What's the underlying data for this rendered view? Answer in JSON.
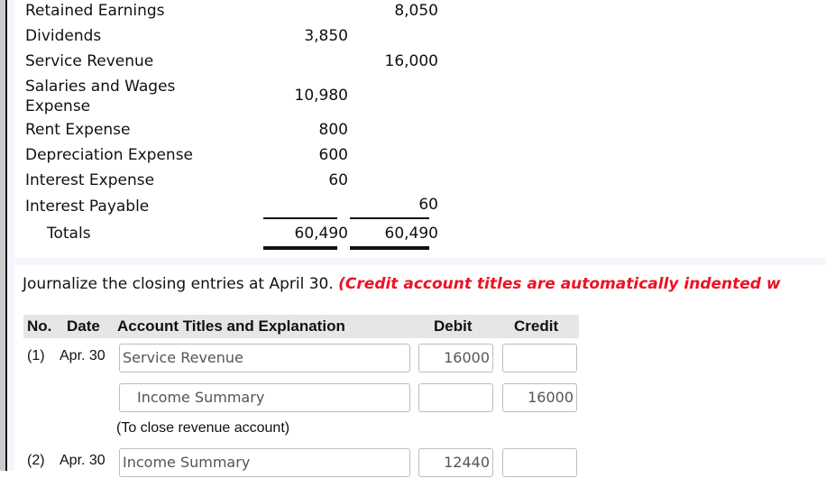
{
  "trial_balance": {
    "rows": [
      {
        "account": "Retained Earnings",
        "debit": "",
        "credit": "8,050"
      },
      {
        "account": "Dividends",
        "debit": "3,850",
        "credit": ""
      },
      {
        "account": "Service Revenue",
        "debit": "",
        "credit": "16,000"
      },
      {
        "account_line1": "Salaries and Wages",
        "account_line2": "Expense",
        "debit": "10,980",
        "credit": ""
      },
      {
        "account": "Rent Expense",
        "debit": "800",
        "credit": ""
      },
      {
        "account": "Depreciation Expense",
        "debit": "600",
        "credit": ""
      },
      {
        "account": "Interest Expense",
        "debit": "60",
        "credit": ""
      },
      {
        "account": "Interest Payable",
        "debit": "",
        "credit": "60"
      }
    ],
    "totals": {
      "label": "Totals",
      "debit": "60,490",
      "credit": "60,490"
    }
  },
  "journal": {
    "instructions": "Journalize the closing entries at April 30.",
    "instructions_note": "(Credit account titles are automatically indented w",
    "note_color": "#ee1122",
    "columns": {
      "no": "No.",
      "date": "Date",
      "account": "Account Titles and Explanation",
      "debit": "Debit",
      "credit": "Credit"
    },
    "entries": [
      {
        "no": "(1)",
        "date": "Apr. 30",
        "lines": [
          {
            "account": "Service Revenue",
            "debit": "16000",
            "credit": ""
          },
          {
            "account": "Income Summary",
            "debit": "",
            "credit": "16000"
          }
        ],
        "explanation": "(To close revenue account)"
      },
      {
        "no": "(2)",
        "date": "Apr. 30",
        "lines": [
          {
            "account": "Income Summary",
            "debit": "12440",
            "credit": ""
          }
        ]
      }
    ]
  }
}
